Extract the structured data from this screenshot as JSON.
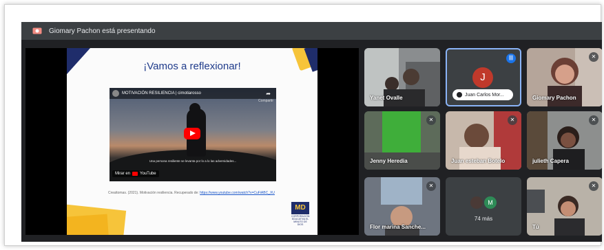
{
  "topbar": {
    "presenter_text": "Giomary Pachon está presentando"
  },
  "slide": {
    "title": "¡Vamos a reflexionar!",
    "video": {
      "title": "MOTIVACIÓN RESILIENCIA | cimotiarosso",
      "share_label": "Compartir",
      "caption": "Una persona resiliente se levanta por lo a lo las adversidades...",
      "watch_on": "Mirar en",
      "yt_label": "YouTube"
    },
    "reference_prefix": "Creattomas. (2021). Motivación resiliencia. Recuperado de:",
    "reference_link": "https://www.youtube.com/watch?v=CuFiABC_XU",
    "logo": {
      "mark": "MD",
      "text": "CORPORACIÓN EDUCATIVA EL MINUTO DE DIOS"
    }
  },
  "participants": [
    {
      "name": "Yanet Ovalle",
      "muted": false
    },
    {
      "name": "Juan Carlos Mor...",
      "initial": "J",
      "speaking": true
    },
    {
      "name": "Giomary Pachon",
      "muted": true
    },
    {
      "name": "Jenny Heredia",
      "muted": true
    },
    {
      "name": "Juan esteban Botelo",
      "muted": true
    },
    {
      "name": "julieth Capera",
      "muted": true
    },
    {
      "name": "Flor marina Sanche...",
      "muted": true
    },
    {
      "name": "74 más",
      "avatar_initial": "M"
    },
    {
      "name": "Tú",
      "muted": true
    }
  ],
  "icons": {
    "mic_off": "mic-off-icon",
    "speaking": "audio-wave-icon",
    "present": "presentation-icon"
  },
  "colors": {
    "accent": "#1a73e8",
    "slide_title": "#1e3a8a",
    "tile_bg": "#3c4043"
  }
}
